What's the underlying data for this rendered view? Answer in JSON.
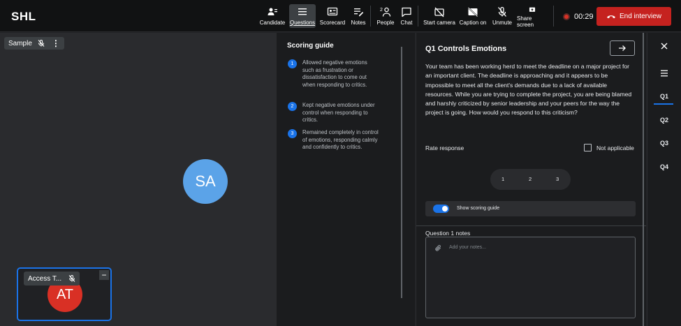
{
  "app": {
    "logo": "SHL"
  },
  "toolbar": {
    "candidate": "Candidate",
    "questions": "Questions",
    "scorecard": "Scorecard",
    "notes": "Notes",
    "people": "People",
    "people_count": "2",
    "chat": "Chat",
    "start_camera": "Start camera",
    "caption_on": "Caption on",
    "unmute": "Unmute",
    "share_screen": "Share screen",
    "timer": "00:29",
    "end_interview": "End interview"
  },
  "video": {
    "main_participant": {
      "name": "Sample",
      "initials": "SA",
      "avatar_color": "#5ba3e8"
    },
    "self_tile": {
      "name": "Access T...",
      "initials": "AT",
      "avatar_color": "#d93025",
      "minimize": "−"
    }
  },
  "scoring_guide": {
    "title": "Scoring guide",
    "items": [
      {
        "num": "1",
        "text": "Allowed negative emotions such as frustration or dissatisfaction to come out when responding to critics."
      },
      {
        "num": "2",
        "text": "Kept negative emotions under control when responding to critics."
      },
      {
        "num": "3",
        "text": "Remained completely in control of emotions, responding calmly and confidently to critics."
      }
    ]
  },
  "question": {
    "title": "Q1 Controls Emotions",
    "text": "Your team has been working herd to meet the deadline on a major project for an important client. The deadline is approaching and it appears to be impossible to meet all the client's demands due to a lack of available resources. While you are trying to complete the project, you are being blamed and harshly criticized by senior leadership and your peers for the way the project is going. How would you respond to this criticism?",
    "rate_label": "Rate response",
    "not_applicable": "Not applicable",
    "ratings": [
      "1",
      "2",
      "3"
    ],
    "show_scoring_guide": "Show scoring guide",
    "notes_label": "Question 1 notes",
    "notes_placeholder": "Add your notes..."
  },
  "rail": {
    "questions": [
      "Q1",
      "Q2",
      "Q3",
      "Q4"
    ],
    "active": "Q1"
  },
  "colors": {
    "accent": "#1a73e8",
    "end_button": "#c5221f",
    "recording": "#d93025"
  }
}
